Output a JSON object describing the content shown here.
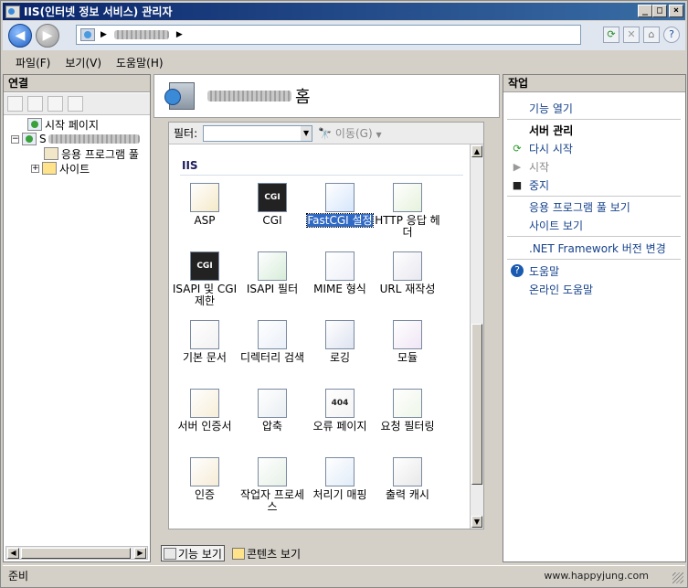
{
  "window": {
    "title": "IIS(인터넷 정보 서비스) 관리자"
  },
  "menu": [
    "파일(F)",
    "보기(V)",
    "도움말(H)"
  ],
  "connections": {
    "title": "연결",
    "tree": [
      {
        "label": "시작 페이지"
      },
      {
        "label": "S"
      },
      {
        "label": "응용 프로그램 풀"
      },
      {
        "label": "사이트"
      }
    ]
  },
  "center": {
    "title_suffix": "홈",
    "filter_label": "필터:",
    "go_label": "이동(G)",
    "group": "IIS",
    "features": [
      {
        "label": "ASP",
        "icon": "asp-icon"
      },
      {
        "label": "CGI",
        "icon": "cgi-icon",
        "badge": "CGI"
      },
      {
        "label": "FastCGI 설정",
        "icon": "fastcgi-icon",
        "selected": true
      },
      {
        "label": "HTTP 응답 헤더",
        "icon": "http-headers-icon"
      },
      {
        "label": "ISAPI 및 CGI 제한",
        "icon": "isapi-cgi-icon",
        "badge": "CGI"
      },
      {
        "label": "ISAPI 필터",
        "icon": "isapi-filter-icon"
      },
      {
        "label": "MIME 형식",
        "icon": "mime-icon"
      },
      {
        "label": "URL 재작성",
        "icon": "url-rewrite-icon"
      },
      {
        "label": "기본 문서",
        "icon": "default-doc-icon"
      },
      {
        "label": "디렉터리 검색",
        "icon": "dir-browse-icon"
      },
      {
        "label": "로깅",
        "icon": "logging-icon"
      },
      {
        "label": "모듈",
        "icon": "modules-icon"
      },
      {
        "label": "서버 인증서",
        "icon": "cert-icon"
      },
      {
        "label": "압축",
        "icon": "compression-icon"
      },
      {
        "label": "오류 페이지",
        "icon": "error-page-icon",
        "badge": "404"
      },
      {
        "label": "요청 필터링",
        "icon": "request-filter-icon"
      },
      {
        "label": "인증",
        "icon": "auth-icon"
      },
      {
        "label": "작업자 프로세스",
        "icon": "worker-process-icon"
      },
      {
        "label": "처리기 매핑",
        "icon": "handler-map-icon"
      },
      {
        "label": "출력 캐시",
        "icon": "output-cache-icon"
      }
    ],
    "view_features": "기능 보기",
    "view_content": "콘텐츠 보기"
  },
  "actions": {
    "title": "작업",
    "open_feature": "기능 열기",
    "server_mgmt": "서버 관리",
    "restart": "다시 시작",
    "start": "시작",
    "stop": "중지",
    "view_pools": "응용 프로그램 풀 보기",
    "view_sites": "사이트 보기",
    "net_version": ".NET Framework 버전 변경",
    "help": "도움말",
    "online_help": "온라인 도움말"
  },
  "status": {
    "text": "준비",
    "watermark": "www.happyjung.com"
  },
  "colors": {
    "title_start": "#0a246a",
    "title_end": "#3a6ea5",
    "link": "#15428b",
    "selection": "#316ac5"
  }
}
